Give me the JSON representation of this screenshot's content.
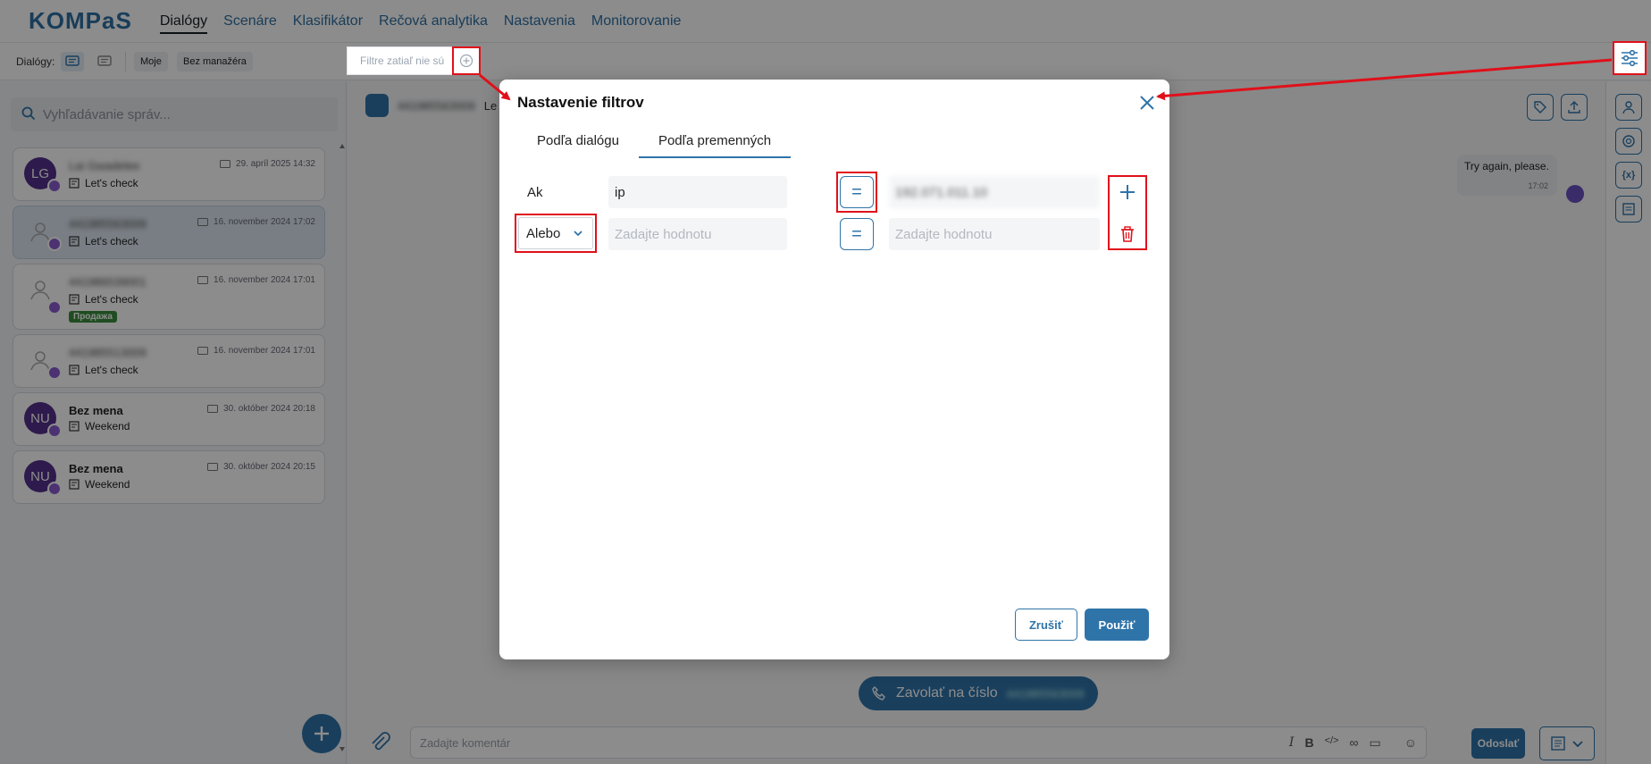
{
  "app": {
    "logo_text": "KOMPaS",
    "brand_color": "#2f74a9",
    "annotation_color": "#e0101a"
  },
  "nav": {
    "items": [
      {
        "label": "Dialógy",
        "active": true
      },
      {
        "label": "Scenáre"
      },
      {
        "label": "Klasifikátor"
      },
      {
        "label": "Rečová analytika"
      },
      {
        "label": "Nastavenia"
      },
      {
        "label": "Monitorovanie"
      }
    ]
  },
  "toolbar": {
    "dialogs_label": "Dialógy:",
    "chip_mine": "Moje",
    "chip_no_manager": "Bez manažéra",
    "filter_placeholder": "Filtre zatiaľ nie sú"
  },
  "search": {
    "placeholder": "Vyhľadávanie správ..."
  },
  "dialogs": [
    {
      "avatar": "LG",
      "name": "Lai Gwadelee",
      "date": "29. apríl 2025 14:32",
      "message": "Let's check",
      "blurred_name": true
    },
    {
      "avatar": "",
      "name": "441985563009",
      "date": "16. november 2024 17:02",
      "message": "Let's check",
      "blurred_name": true,
      "selected": true
    },
    {
      "avatar": "",
      "name": "441986539001",
      "date": "16. november 2024 17:01",
      "message": "Let's check",
      "tag": "Продажа",
      "blurred_name": true
    },
    {
      "avatar": "",
      "name": "441985513009",
      "date": "16. november 2024 17:01",
      "message": "Let's check",
      "blurred_name": true
    },
    {
      "avatar": "NU",
      "name": "Bez mena",
      "date": "30. október 2024 20:18",
      "message": "Weekend"
    },
    {
      "avatar": "NU",
      "name": "Bez mena",
      "date": "30. október 2024 20:15",
      "message": "Weekend"
    }
  ],
  "chat": {
    "header_name": "441985563009",
    "header_suffix": "Le",
    "bubble_text": "Try again, please.",
    "bubble_time": "17:02",
    "call_label": "Zavolať na číslo",
    "call_number": "441985563009",
    "composer_placeholder": "Zadajte komentár",
    "send_label": "Odoslať"
  },
  "modal": {
    "title": "Nastavenie filtrov",
    "tabs": [
      {
        "label": "Podľa dialógu"
      },
      {
        "label": "Podľa premenných",
        "active": true
      }
    ],
    "row1": {
      "label": "Ak",
      "variable_value": "ip",
      "operator": "=",
      "compare_value": "192.071.011.10"
    },
    "row2": {
      "connector": "Alebo",
      "variable_placeholder": "Zadajte hodnotu",
      "operator": "=",
      "compare_placeholder": "Zadajte hodnotu"
    },
    "cancel_label": "Zrušiť",
    "apply_label": "Použiť"
  }
}
